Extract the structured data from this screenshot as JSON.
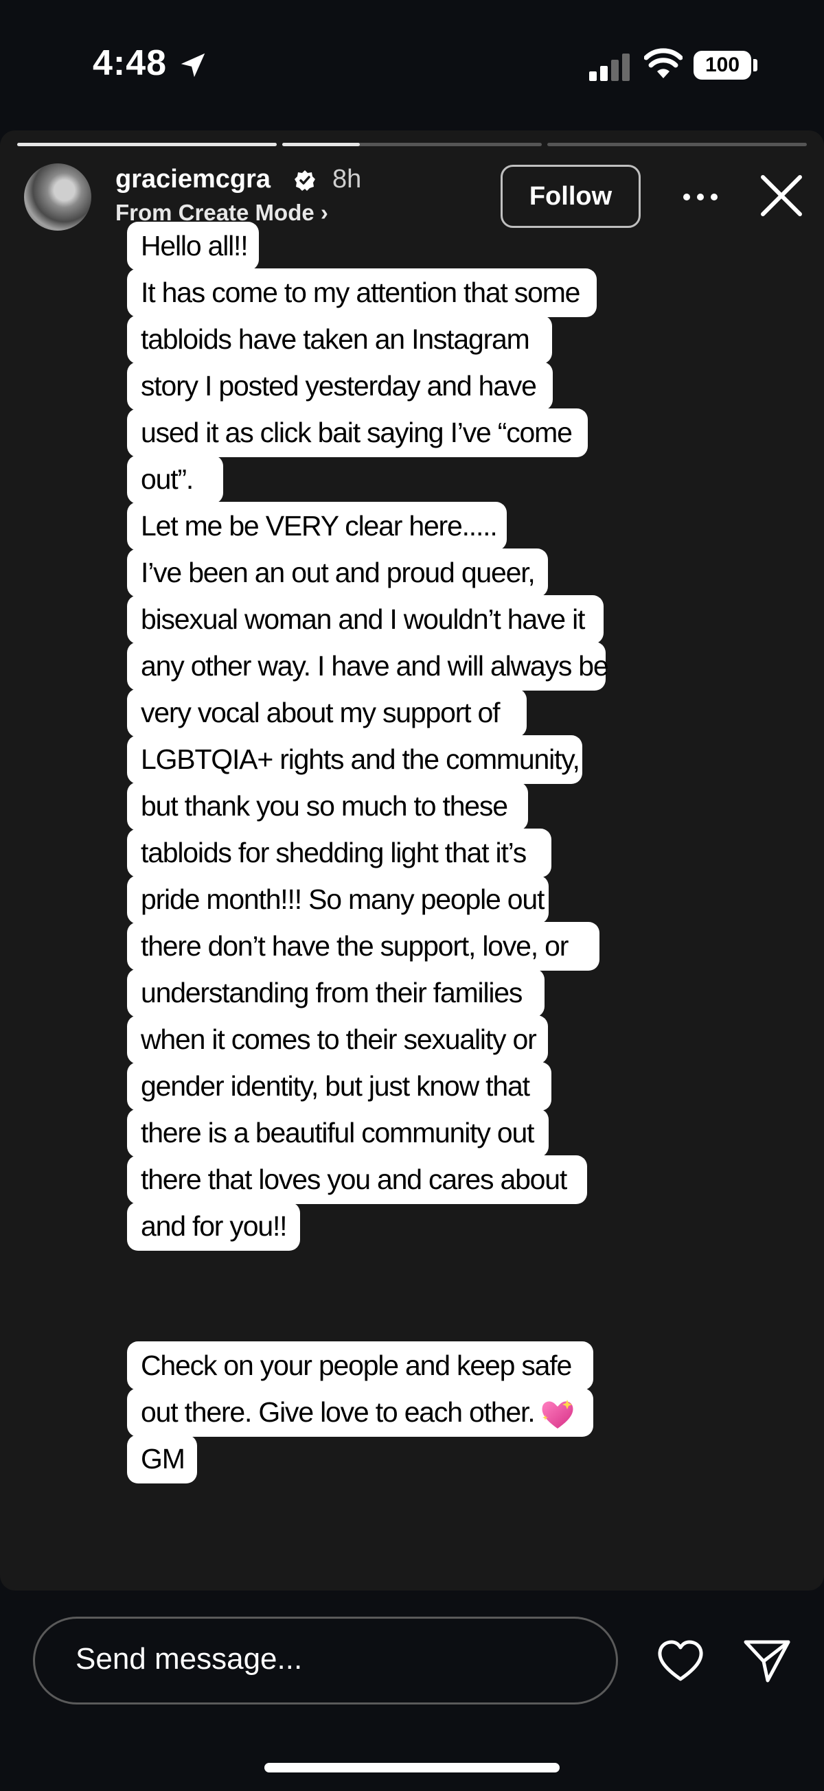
{
  "status_bar": {
    "time": "4:48",
    "battery": "100",
    "icons": [
      "location-arrow-icon",
      "cellular-signal-icon",
      "wifi-icon",
      "battery-icon"
    ]
  },
  "story": {
    "progress_segments": [
      1.0,
      0.3,
      0.0
    ],
    "username": "graciemcgra",
    "verified": true,
    "time_ago": "8h",
    "subtitle": "From Create Mode ›",
    "follow_label": "Follow",
    "text_lines": [
      "Hello all!!",
      "It has come to my attention that some",
      "tabloids have taken an Instagram",
      "story I posted yesterday and have",
      "used it as click bait saying I’ve “come",
      "out”.",
      "Let me be VERY clear here.....",
      "I’ve been an out and proud queer,",
      "bisexual woman and I wouldn’t have it",
      "any other way. I have and will always be",
      "very vocal about my support of",
      "LGBTQIA+ rights and the community,",
      "but thank you so much to these",
      "tabloids for shedding light that it’s",
      "pride month!!! So many people out",
      "there don’t have the support, love, or",
      "understanding from their families",
      "when it comes to their sexuality or",
      "gender identity, but just know that",
      "there is a beautiful community out",
      "there that loves you and cares about",
      "and for you!!"
    ],
    "text_lines_2": [
      "Check on your people and keep safe",
      "out there. Give love to each other.",
      "GM"
    ],
    "emoji": "sparkling-heart-icon"
  },
  "bottom_bar": {
    "message_placeholder": "Send message...",
    "icons": [
      "heart-icon",
      "send-icon"
    ]
  },
  "colors": {
    "background": "#0c0e12",
    "story_background": "#191919",
    "text_highlight": "#ffffff",
    "emoji_pink": "#e7509b"
  }
}
